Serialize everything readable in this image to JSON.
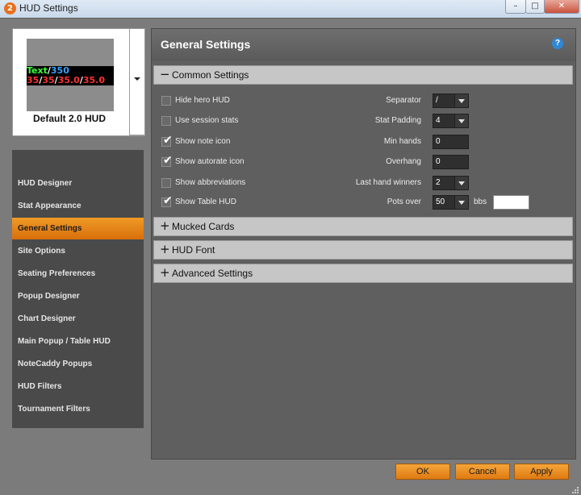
{
  "window": {
    "title": "HUD Settings",
    "buttons": [
      "–",
      "□",
      "✕"
    ]
  },
  "preview": {
    "row1": [
      {
        "text": "Text",
        "color": "#3cff3c"
      },
      {
        "text": "/",
        "color": "#ffffff"
      },
      {
        "text": "350",
        "color": "#3aa0ff"
      }
    ],
    "row2": [
      {
        "text": "35",
        "color": "#ff3030"
      },
      {
        "text": "/",
        "color": "#ffffff"
      },
      {
        "text": "35",
        "color": "#ff3030"
      },
      {
        "text": "/",
        "color": "#ffffff"
      },
      {
        "text": "35.0",
        "color": "#ff3030"
      },
      {
        "text": "/",
        "color": "#ffffff"
      },
      {
        "text": "35.0",
        "color": "#ff3030"
      }
    ],
    "name": "Default 2.0 HUD"
  },
  "nav": {
    "items": [
      {
        "label": "HUD Designer",
        "active": false
      },
      {
        "label": "Stat Appearance",
        "active": false
      },
      {
        "label": "General Settings",
        "active": true
      },
      {
        "label": "Site Options",
        "active": false
      },
      {
        "label": "Seating Preferences",
        "active": false
      },
      {
        "label": "Popup Designer",
        "active": false
      },
      {
        "label": "Chart Designer",
        "active": false
      },
      {
        "label": "Main Popup / Table HUD",
        "active": false
      },
      {
        "label": "NoteCaddy Popups",
        "active": false
      },
      {
        "label": "HUD Filters",
        "active": false
      },
      {
        "label": "Tournament Filters",
        "active": false
      }
    ]
  },
  "panel": {
    "title": "General Settings",
    "help": "?",
    "sections": [
      {
        "sign": "−",
        "label": "Common Settings"
      },
      {
        "sign": "+",
        "label": "Mucked Cards"
      },
      {
        "sign": "+",
        "label": "HUD Font"
      },
      {
        "sign": "+",
        "label": "Advanced Settings"
      }
    ],
    "options": [
      {
        "label": "Hide hero HUD",
        "checked": false
      },
      {
        "label": "Use session stats",
        "checked": false
      },
      {
        "label": "Show note icon",
        "checked": true
      },
      {
        "label": "Show autorate icon",
        "checked": true
      },
      {
        "label": "Show abbreviations",
        "checked": false
      },
      {
        "label": "Show Table HUD",
        "checked": true
      }
    ],
    "fields": {
      "separator": {
        "label": "Separator",
        "value": "/"
      },
      "stat_padding": {
        "label": "Stat Padding",
        "value": "4"
      },
      "min_hands": {
        "label": "Min hands",
        "value": "0"
      },
      "overhang": {
        "label": "Overhang",
        "value": "0"
      },
      "last_hand_winners": {
        "label": "Last hand winners",
        "value": "2"
      },
      "pots_over": {
        "label": "Pots over",
        "value": "50",
        "unit": "bbs",
        "extra_value": ""
      }
    }
  },
  "footer": {
    "ok": "OK",
    "cancel": "Cancel",
    "apply": "Apply"
  },
  "colors": {
    "accent": "#e8821a",
    "panel_bg": "#5f5f5f",
    "nav_bg": "#4a4a4a"
  }
}
